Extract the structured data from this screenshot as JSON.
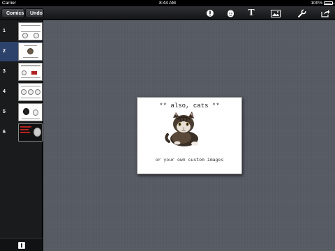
{
  "status_bar": {
    "carrier": "Carrier",
    "time": "8:44 AM",
    "battery": "100%"
  },
  "toolbar": {
    "comics_label": "Comics",
    "undo_label": "Undo",
    "icons": [
      "info-drop-icon",
      "sticker-icon",
      "text-icon",
      "image-icon",
      "wrench-icon",
      "share-icon"
    ],
    "text_icon_glyph": "T"
  },
  "sidebar": {
    "pages": [
      {
        "number": "1",
        "selected": false
      },
      {
        "number": "2",
        "selected": true
      },
      {
        "number": "3",
        "selected": false
      },
      {
        "number": "4",
        "selected": false
      },
      {
        "number": "5",
        "selected": false
      },
      {
        "number": "6",
        "selected": false
      }
    ],
    "add_page_icon": "add-page-icon"
  },
  "panel": {
    "caption_top": "** also, cats **",
    "caption_bottom": "or your own custom images",
    "image": "kitten-photo"
  },
  "colors": {
    "selected_row": "#2c426a",
    "canvas": "#575b64",
    "toolbar": "#1e1f21"
  }
}
